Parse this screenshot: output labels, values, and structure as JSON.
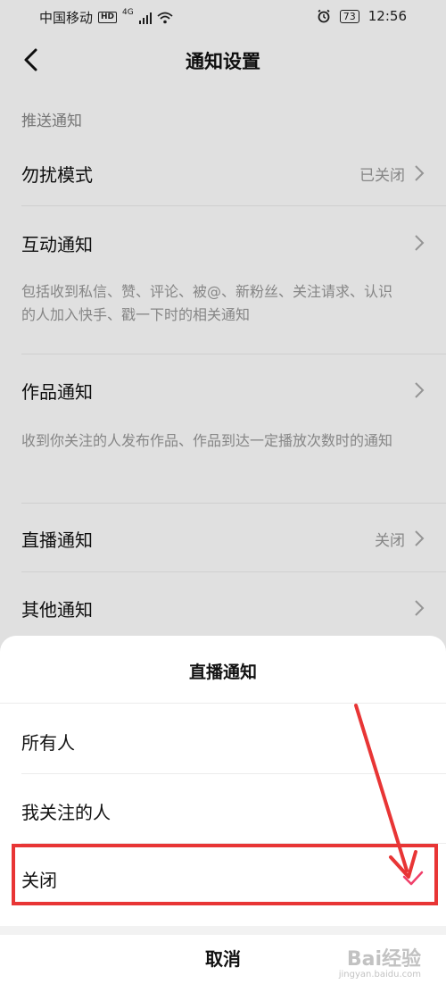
{
  "status_bar": {
    "carrier": "中国移动",
    "hd": "HD",
    "network": "4G",
    "battery": "73",
    "time": "12:56"
  },
  "nav": {
    "title": "通知设置"
  },
  "section": {
    "label": "推送通知"
  },
  "items": [
    {
      "label": "勿扰模式",
      "value": "已关闭"
    },
    {
      "label": "互动通知",
      "desc": "包括收到私信、赞、评论、被@、新粉丝、关注请求、认识的人加入快手、戳一下时的相关通知"
    },
    {
      "label": "作品通知",
      "desc": "收到你关注的人发布作品、作品到达一定播放次数时的通知"
    },
    {
      "label": "直播通知",
      "value": "关闭"
    },
    {
      "label": "其他通知"
    }
  ],
  "sheet": {
    "title": "直播通知",
    "options": [
      {
        "label": "所有人",
        "selected": false
      },
      {
        "label": "我关注的人",
        "selected": false
      },
      {
        "label": "关闭",
        "selected": true
      }
    ],
    "cancel": "取消"
  },
  "colors": {
    "accent": "#f0406a",
    "highlight": "#e83535"
  },
  "watermark": {
    "text": "Bai经验",
    "sub": "jingyan.baidu.com"
  }
}
